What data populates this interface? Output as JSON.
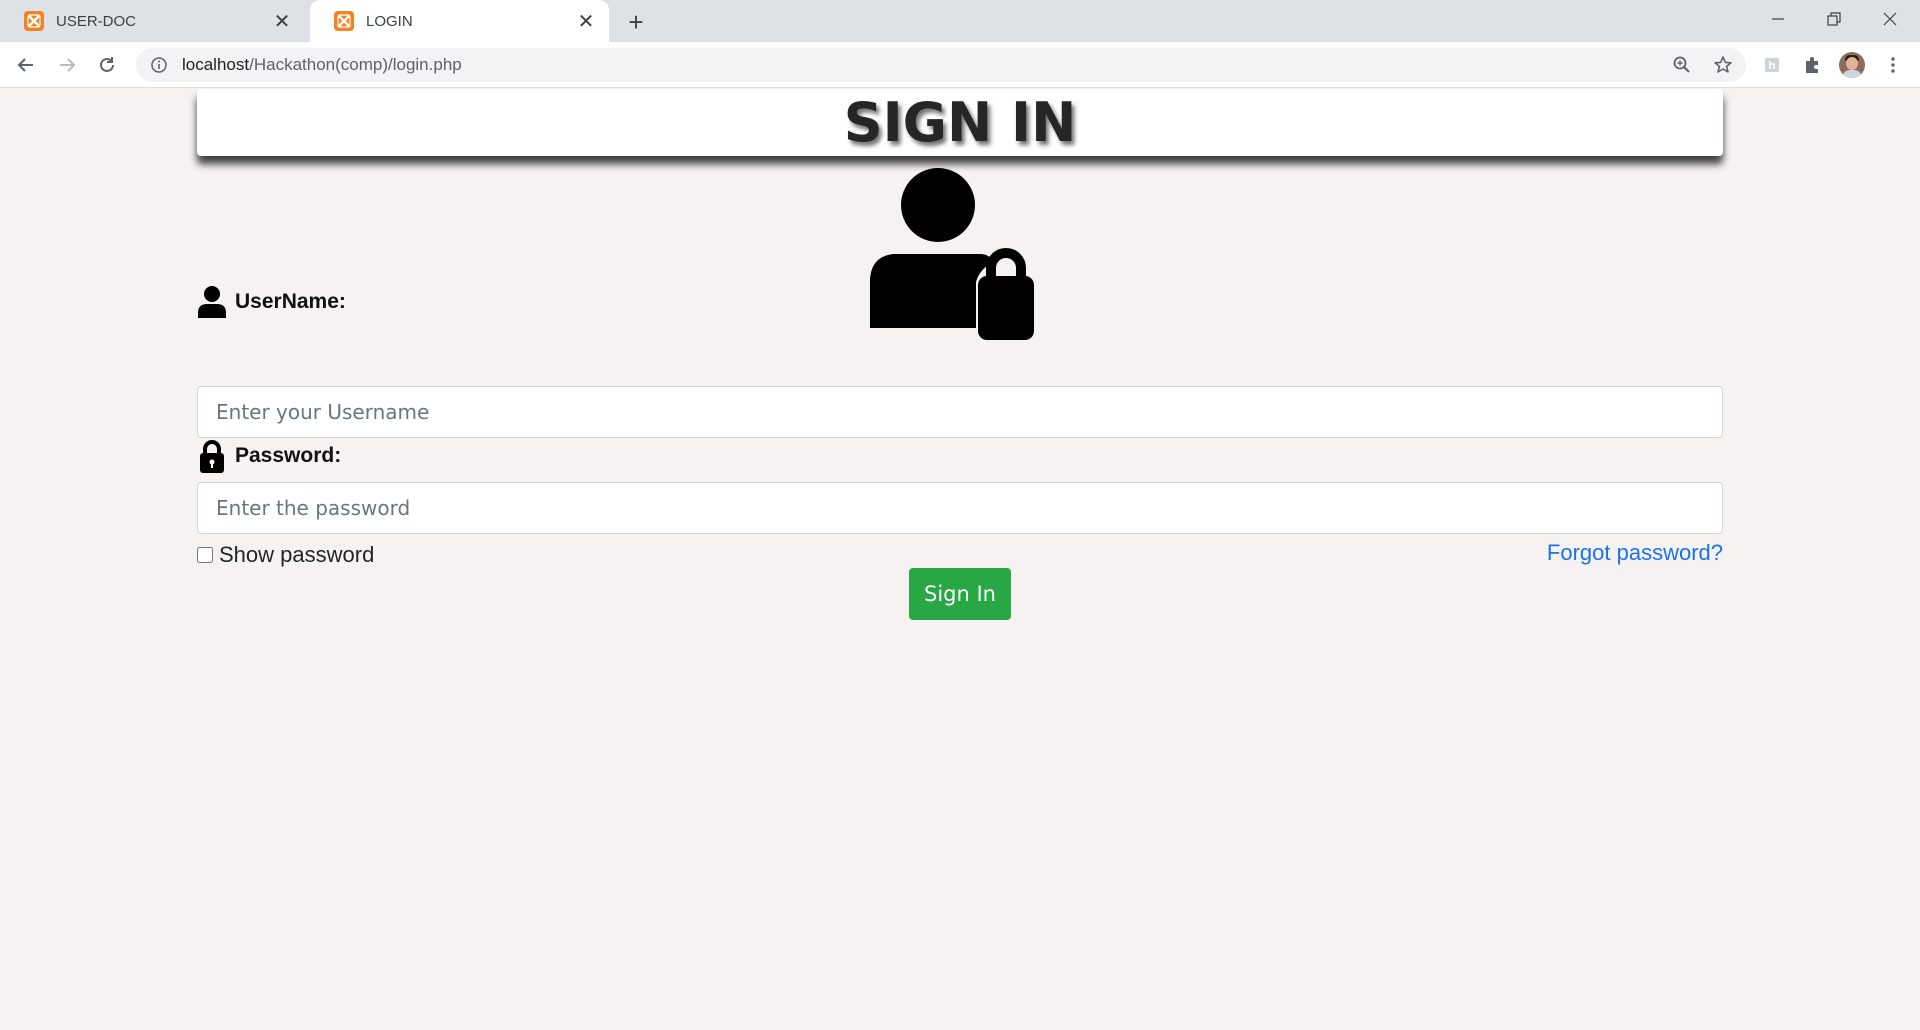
{
  "browser": {
    "tabs": [
      {
        "title": "USER-DOC",
        "icon": "xampp-favicon-icon",
        "active": false
      },
      {
        "title": "LOGIN",
        "icon": "xampp-favicon-icon",
        "active": true
      }
    ],
    "address": {
      "host": "localhost",
      "path": "/Hackathon(comp)/login.php"
    },
    "colors": {
      "tabstrip": "#dee1e6",
      "favicon": "#f58220"
    }
  },
  "page": {
    "heading": "SIGN IN",
    "hero_icon": "user-lock-icon",
    "username": {
      "label": "UserName:",
      "icon": "user-icon",
      "placeholder": "Enter your Username"
    },
    "password": {
      "label": "Password:",
      "icon": "lock-icon",
      "placeholder": "Enter the password"
    },
    "show_password_label": "Show password",
    "forgot_password_label": "Forgot password?",
    "submit_label": "Sign In",
    "colors": {
      "background": "#f6f2f1",
      "submit": "#28a745",
      "link": "#1a73e8"
    }
  }
}
